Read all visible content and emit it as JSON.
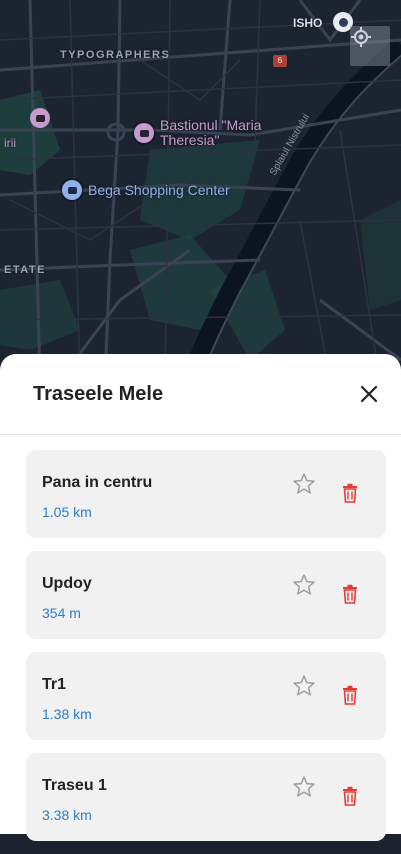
{
  "map": {
    "labels": {
      "typographers": "TYPOGRAPHERS",
      "isho": "ISHO",
      "etate": "ETATE",
      "irii": "irii",
      "bastion": "Bastionul \"Maria Theresia\"",
      "bega": "Bega Shopping Center",
      "splaiul": "Splaiul Nistrului",
      "road_number": "6"
    },
    "colors": {
      "background": "#1d2431",
      "road": "#3a4354",
      "park": "#1f4a44",
      "river": "#0d1421",
      "poi_purple": "#c59bd0",
      "poi_blue": "#8fb1ec"
    },
    "icons": {
      "locate": "crosshair-icon",
      "bastion": "camera-icon",
      "bega": "shopping-bag-icon"
    }
  },
  "sheet": {
    "title": "Traseele Mele",
    "close_icon": "close-icon",
    "routes": [
      {
        "name": "Pana in centru",
        "distance": "1.05 km"
      },
      {
        "name": "Updoy",
        "distance": "354 m"
      },
      {
        "name": "Tr1",
        "distance": "1.38 km"
      },
      {
        "name": "Traseu 1",
        "distance": "3.38 km"
      }
    ],
    "colors": {
      "distance": "#2a7fc8",
      "delete": "#e53935",
      "star": "#9e9e9e",
      "card": "#f1f1f1"
    }
  }
}
